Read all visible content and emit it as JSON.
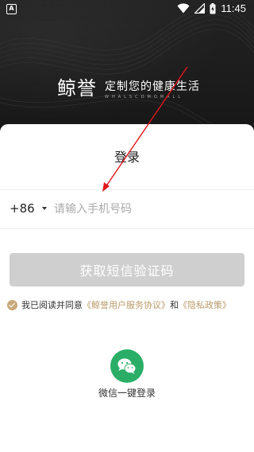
{
  "status_bar": {
    "left_icon_letter": "A",
    "time": "11:45"
  },
  "brand": {
    "logo_text": "鲸誉",
    "slogan": "定制您的健康生活",
    "subtext": "WHALSCOMOMALL"
  },
  "login": {
    "title": "登录",
    "country_code": "+86",
    "phone_placeholder": "请输入手机号码",
    "get_code_button": "获取短信验证码",
    "agreement": {
      "prefix": "我已阅读并同意",
      "service_link": "《鲸誉用户服务协议》",
      "conjunction": "和",
      "privacy_link": "《隐私政策》"
    },
    "wechat_label": "微信一键登录"
  },
  "colors": {
    "accent_gold": "#c9aa7c",
    "link_gold": "#b89a6a",
    "wechat_green": "#2aae67",
    "disabled_button": "#cfcfcf",
    "annotation_red": "#e0161d"
  }
}
